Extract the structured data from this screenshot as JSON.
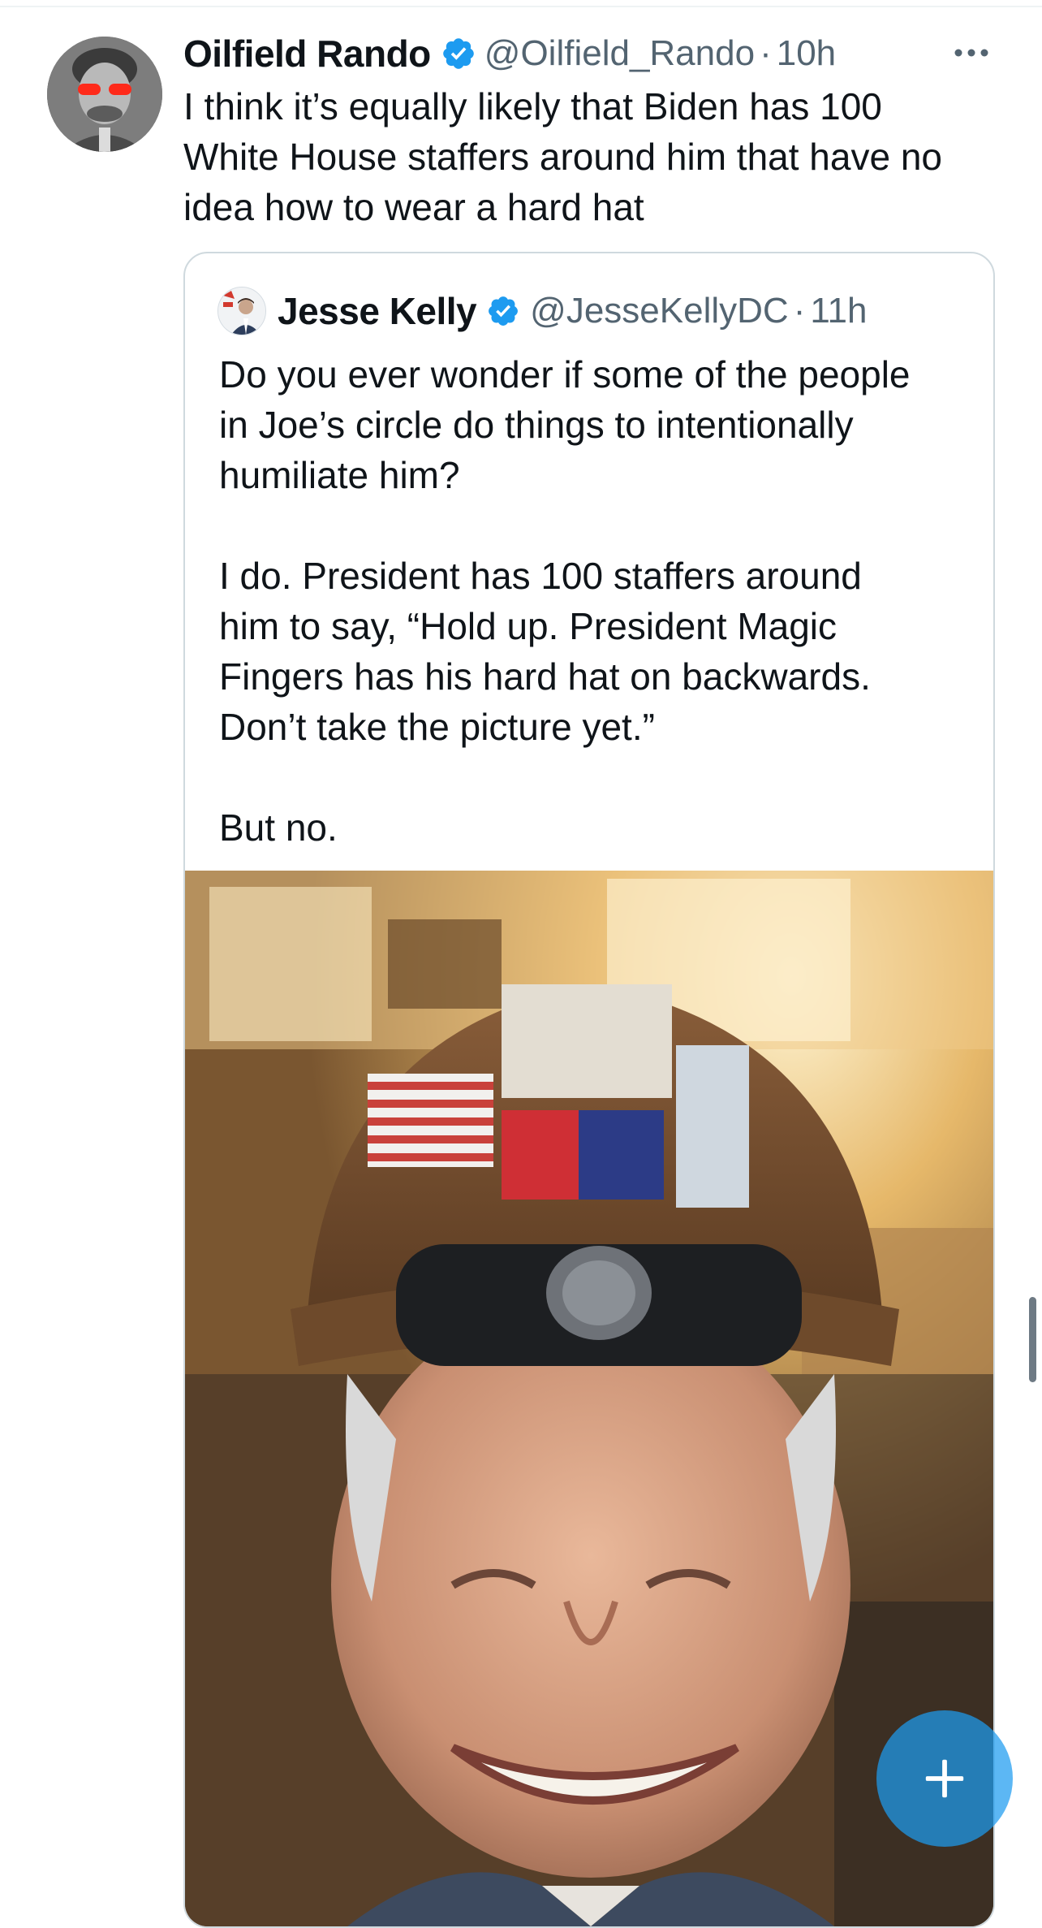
{
  "tweet": {
    "display_name": "Oilfield Rando",
    "handle": "@Oilfield_Rando",
    "separator": "·",
    "time": "10h",
    "text": "I think it’s equally likely that Biden has 100\nWhite House staffers around him that have no\nidea how to wear a hard hat",
    "more_icon": "more-horizontal-icon",
    "verified_icon": "verified-badge-icon"
  },
  "quoted_tweet": {
    "display_name": "Jesse Kelly",
    "handle": "@JesseKellyDC",
    "separator": "·",
    "time": "11h",
    "text": "Do you ever wonder if some of the people\nin Joe’s circle do things to intentionally\nhumiliate him?\n\nI do. President has 100 staffers around\nhim to say, “Hold up. President Magic\nFingers has his hard hat on backwards.\nDon’t take the picture yet.”\n\nBut no."
  },
  "compose_button": {
    "icon": "plus-icon"
  },
  "colors": {
    "accent": "#1d9bf0",
    "text_primary": "#0f1419",
    "text_secondary": "#536471",
    "border": "#cfd9de"
  }
}
